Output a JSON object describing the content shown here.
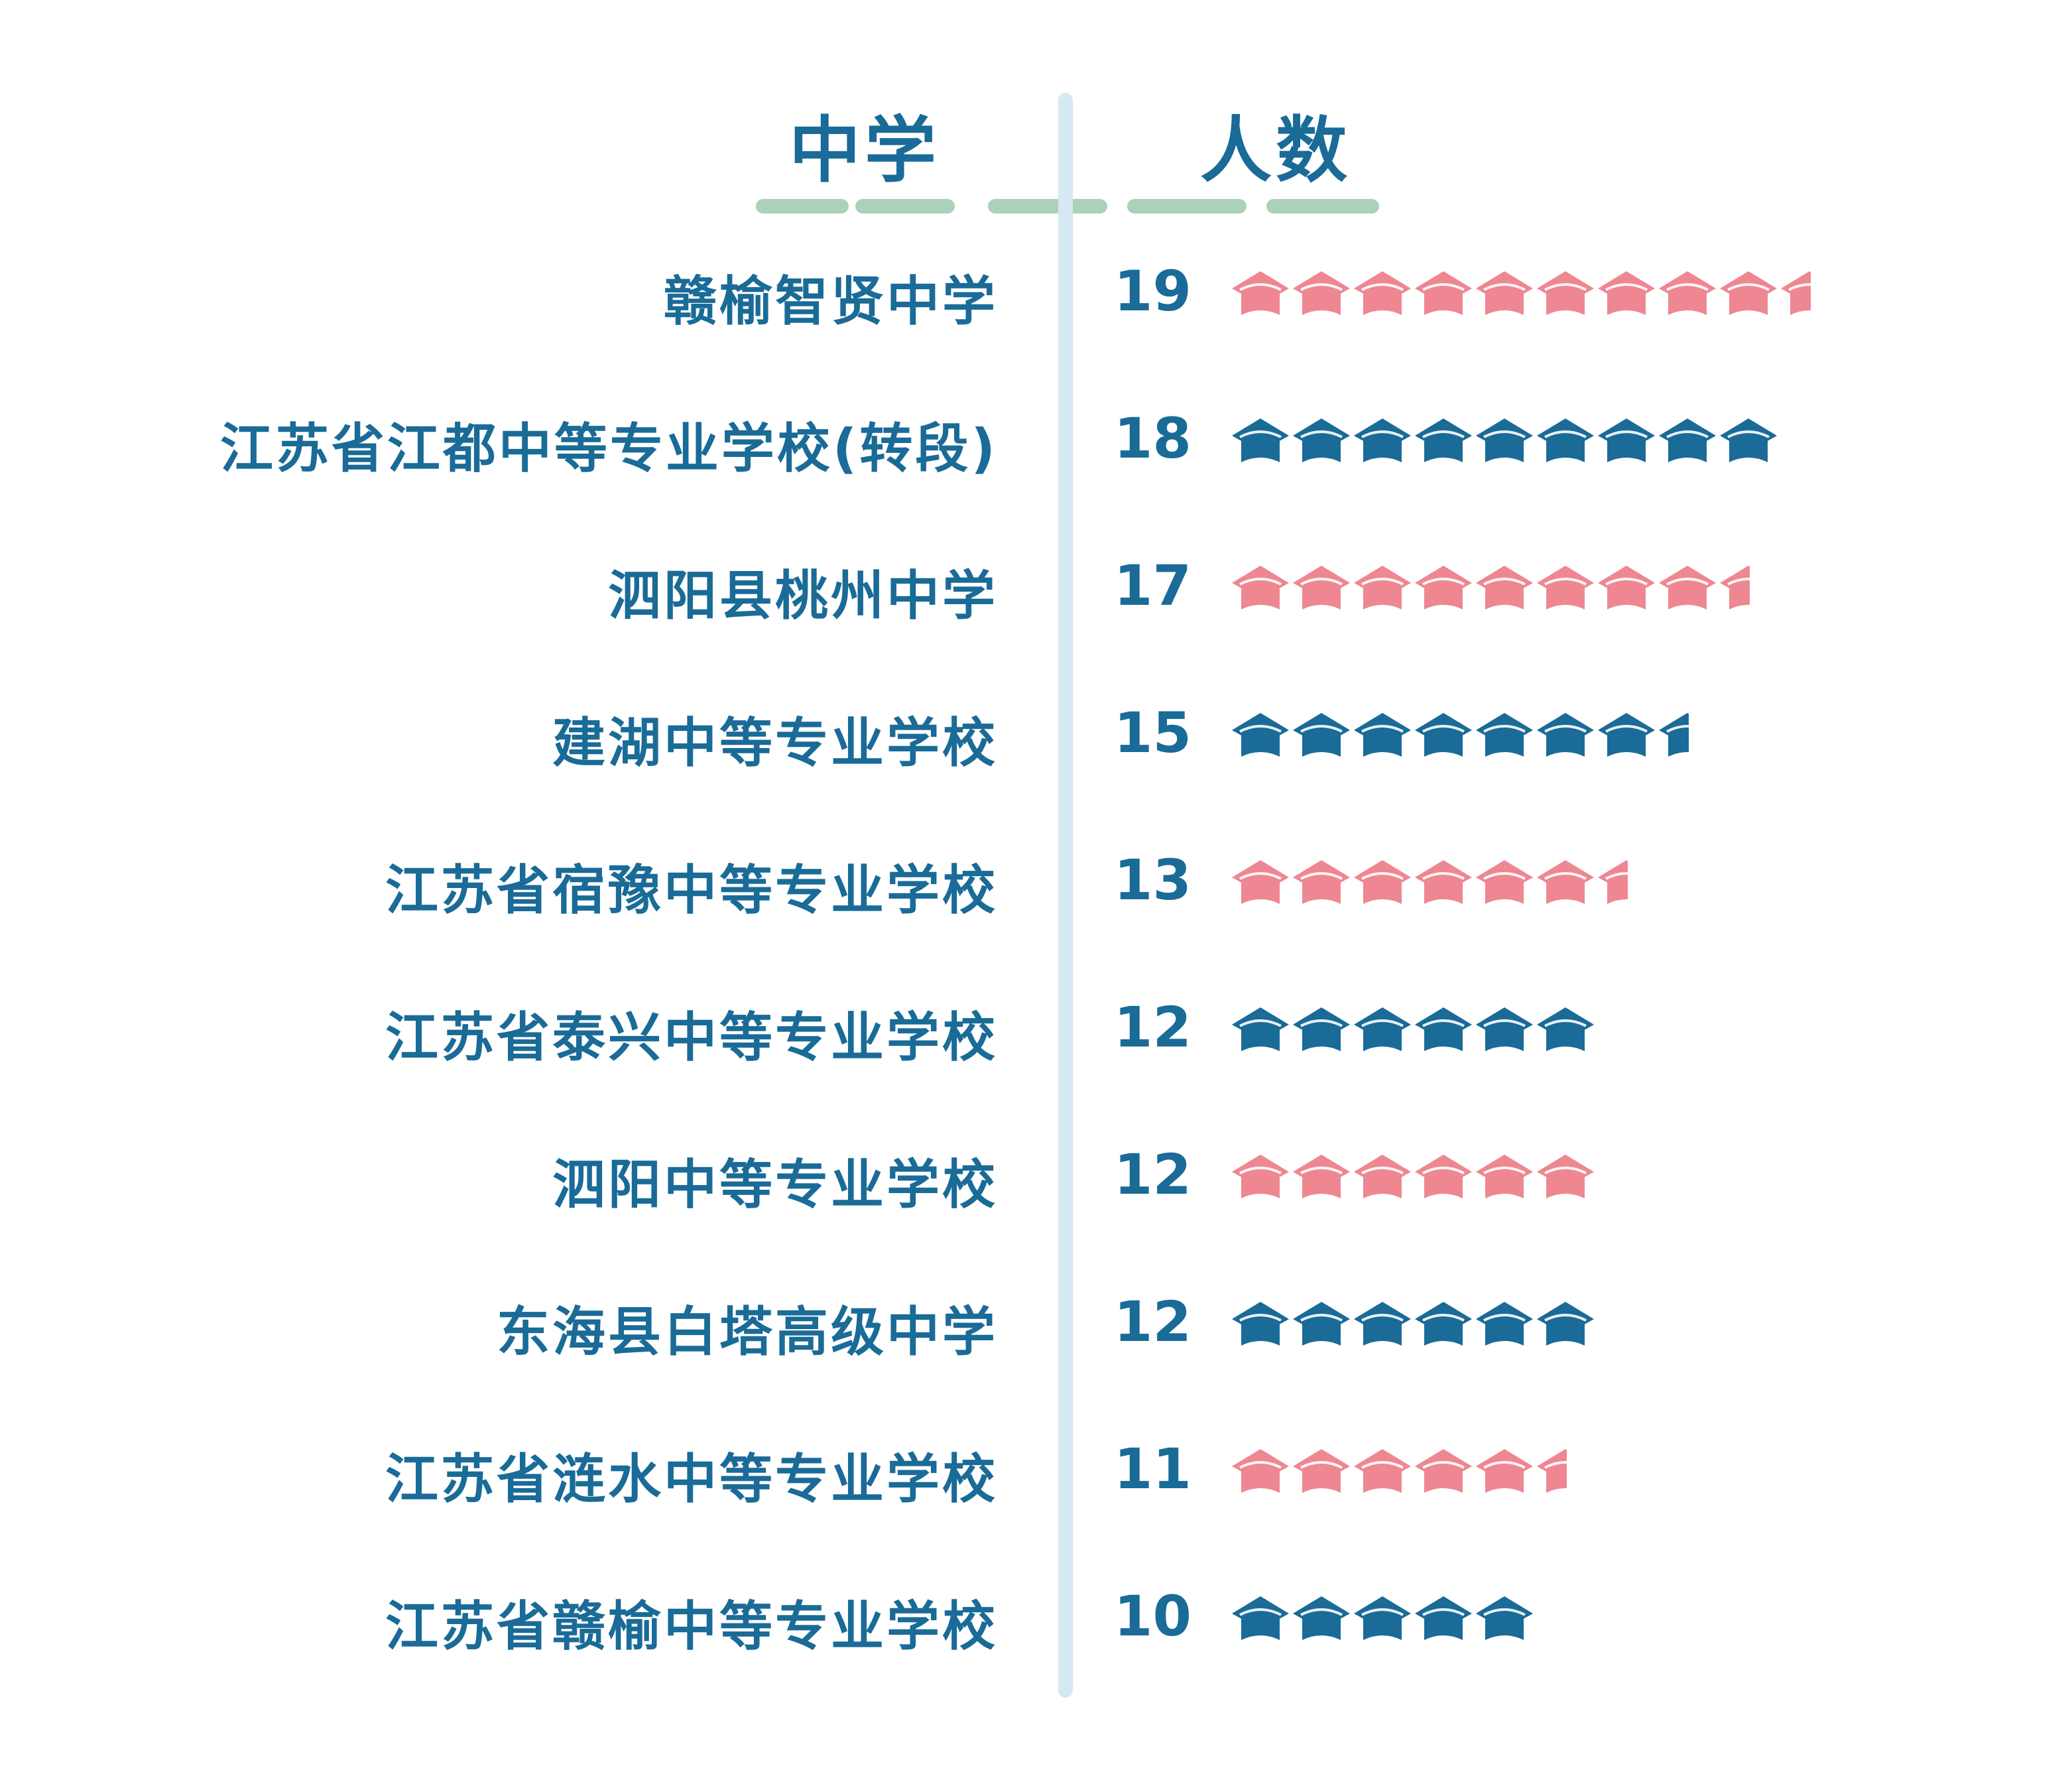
{
  "chart_data": {
    "type": "bar",
    "header_school": "中学",
    "header_count": "人数",
    "categories": [
      "赣榆智贤中学",
      "江苏省江都中等专业学校(转段)",
      "泗阳县桃州中学",
      "建湖中等专业学校",
      "江苏省宿豫中等专业学校",
      "江苏省泰兴中等专业学校",
      "泗阳中等专业学校",
      "东海县白塔高级中学",
      "江苏省涟水中等专业学校",
      "江苏省赣榆中等专业学校"
    ],
    "values": [
      19,
      18,
      17,
      15,
      13,
      12,
      12,
      12,
      11,
      10
    ],
    "colors": {
      "pink": "#ee8791",
      "blue": "#1a6b97",
      "divider": "#d6e9f2",
      "header_wash": "#9ec9ae"
    },
    "icon": "graduation-cap-icon",
    "people_per_icon": 2
  }
}
